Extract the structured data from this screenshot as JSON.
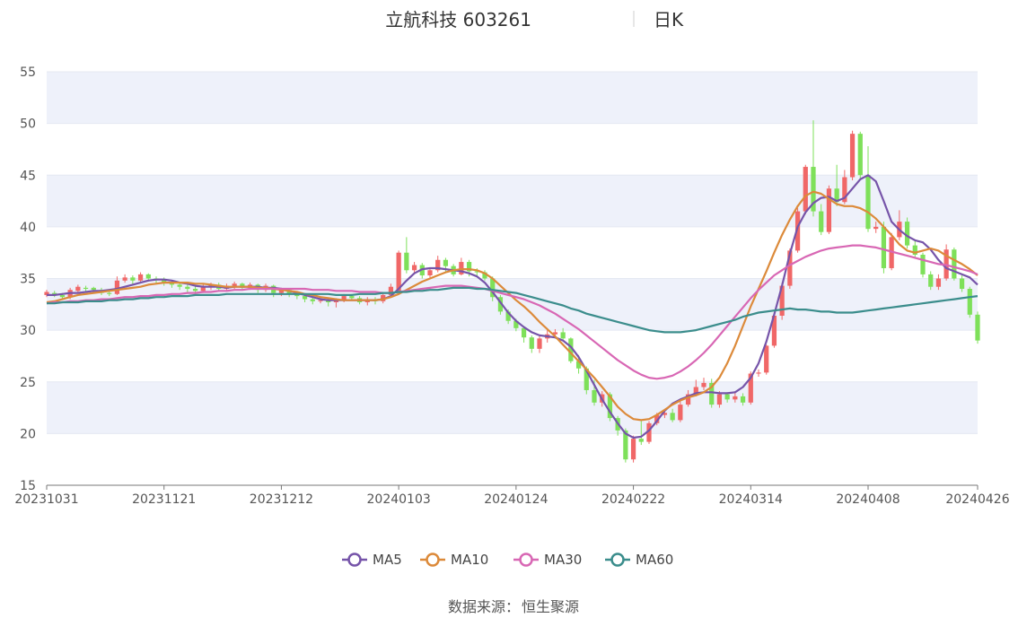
{
  "header": {
    "title": "立航科技 603261",
    "period": "日K"
  },
  "footer": {
    "source_label": "数据来源：",
    "source_value": "恒生聚源"
  },
  "colors": {
    "up": "#f06767",
    "down": "#7ee05a",
    "ma5": "#7654a9",
    "ma10": "#dc8a3a",
    "ma30": "#d867b4",
    "ma60": "#3b8d8c",
    "band": "#eef1fa",
    "axis": "#777777"
  },
  "chart_data": {
    "type": "candlestick",
    "title": "立航科技 603261",
    "subtitle": "日K",
    "ylim": [
      15,
      55
    ],
    "y_ticks": [
      "15",
      "20",
      "25",
      "30",
      "35",
      "40",
      "45",
      "50",
      "55"
    ],
    "x_ticks": [
      "20231031",
      "20231121",
      "20231212",
      "20240103",
      "20240124",
      "20240222",
      "20240314",
      "20240408",
      "20240426"
    ],
    "x_tick_index": [
      0,
      15,
      30,
      45,
      60,
      75,
      90,
      105,
      119
    ],
    "candles": [
      [
        33.4,
        33.7,
        33.2,
        33.9
      ],
      [
        33.6,
        33.4,
        33.2,
        33.8
      ],
      [
        33.4,
        33.2,
        33.0,
        33.6
      ],
      [
        33.2,
        33.9,
        33.0,
        34.1
      ],
      [
        33.8,
        34.2,
        33.6,
        34.4
      ],
      [
        34.1,
        34.0,
        33.7,
        34.3
      ],
      [
        34.1,
        33.9,
        33.6,
        34.2
      ],
      [
        33.9,
        33.6,
        33.4,
        34.1
      ],
      [
        33.6,
        33.5,
        33.3,
        33.9
      ],
      [
        33.5,
        34.8,
        33.4,
        35.2
      ],
      [
        34.8,
        35.1,
        34.6,
        35.4
      ],
      [
        35.1,
        34.8,
        34.4,
        35.3
      ],
      [
        34.8,
        35.4,
        34.6,
        35.6
      ],
      [
        35.4,
        35.0,
        34.7,
        35.5
      ],
      [
        35.0,
        34.9,
        34.5,
        35.2
      ],
      [
        34.9,
        34.6,
        34.3,
        35.1
      ],
      [
        34.6,
        34.4,
        34.1,
        34.8
      ],
      [
        34.4,
        34.2,
        33.9,
        34.6
      ],
      [
        34.2,
        34.0,
        33.7,
        34.4
      ],
      [
        34.0,
        33.8,
        33.5,
        34.3
      ],
      [
        33.8,
        34.2,
        33.6,
        34.5
      ],
      [
        34.2,
        34.4,
        33.9,
        34.6
      ],
      [
        34.4,
        34.0,
        33.8,
        34.6
      ],
      [
        34.0,
        34.3,
        33.8,
        34.5
      ],
      [
        34.3,
        34.5,
        34.0,
        34.7
      ],
      [
        34.5,
        34.1,
        33.9,
        34.6
      ],
      [
        34.1,
        34.4,
        33.9,
        34.6
      ],
      [
        34.4,
        33.9,
        33.6,
        34.5
      ],
      [
        33.9,
        34.3,
        33.7,
        34.5
      ],
      [
        34.3,
        33.6,
        33.2,
        34.4
      ],
      [
        33.6,
        33.9,
        33.3,
        34.1
      ],
      [
        33.9,
        33.5,
        33.2,
        34.0
      ],
      [
        33.5,
        33.3,
        33.0,
        33.7
      ],
      [
        33.3,
        33.0,
        32.7,
        33.4
      ],
      [
        33.0,
        32.8,
        32.5,
        33.2
      ],
      [
        32.8,
        32.9,
        32.6,
        33.2
      ],
      [
        32.9,
        32.7,
        32.3,
        33.1
      ],
      [
        32.7,
        32.9,
        32.2,
        33.1
      ],
      [
        32.9,
        33.3,
        32.7,
        33.5
      ],
      [
        33.3,
        33.1,
        32.9,
        33.5
      ],
      [
        33.1,
        32.7,
        32.5,
        33.3
      ],
      [
        32.7,
        33.0,
        32.4,
        33.2
      ],
      [
        33.0,
        32.8,
        32.5,
        33.2
      ],
      [
        32.8,
        33.4,
        32.6,
        33.6
      ],
      [
        33.4,
        34.2,
        33.2,
        34.5
      ],
      [
        33.8,
        37.5,
        33.6,
        37.7
      ],
      [
        37.5,
        35.8,
        35.5,
        39.0
      ],
      [
        35.8,
        36.3,
        35.5,
        36.6
      ],
      [
        36.3,
        35.3,
        35.0,
        36.5
      ],
      [
        35.3,
        35.8,
        35.1,
        36.0
      ],
      [
        35.8,
        36.8,
        35.6,
        37.2
      ],
      [
        36.8,
        36.2,
        35.6,
        37.0
      ],
      [
        36.2,
        35.4,
        35.2,
        36.4
      ],
      [
        35.4,
        36.6,
        35.3,
        37.0
      ],
      [
        36.6,
        35.7,
        35.2,
        36.8
      ],
      [
        35.7,
        35.6,
        35.2,
        36.0
      ],
      [
        35.6,
        35.0,
        34.8,
        35.8
      ],
      [
        35.0,
        33.2,
        32.8,
        35.2
      ],
      [
        33.2,
        31.8,
        31.5,
        33.4
      ],
      [
        31.8,
        30.9,
        30.6,
        32.0
      ],
      [
        30.9,
        30.2,
        29.9,
        31.1
      ],
      [
        30.2,
        29.3,
        28.8,
        30.4
      ],
      [
        29.3,
        28.2,
        27.8,
        29.5
      ],
      [
        28.2,
        29.2,
        27.8,
        29.5
      ],
      [
        29.2,
        29.6,
        28.8,
        30.0
      ],
      [
        29.6,
        29.8,
        29.3,
        30.1
      ],
      [
        29.8,
        29.2,
        28.9,
        30.2
      ],
      [
        29.2,
        27.0,
        26.8,
        29.3
      ],
      [
        27.0,
        26.3,
        25.8,
        27.6
      ],
      [
        26.3,
        24.2,
        23.8,
        26.5
      ],
      [
        24.2,
        23.0,
        22.7,
        25.2
      ],
      [
        23.0,
        23.8,
        22.6,
        24.1
      ],
      [
        23.8,
        21.5,
        21.2,
        24.0
      ],
      [
        21.5,
        20.3,
        19.8,
        21.7
      ],
      [
        20.3,
        17.5,
        17.2,
        20.5
      ],
      [
        17.5,
        19.5,
        17.2,
        19.8
      ],
      [
        19.5,
        19.2,
        18.9,
        21.2
      ],
      [
        19.2,
        21.0,
        19.0,
        21.2
      ],
      [
        21.0,
        21.8,
        20.8,
        22.0
      ],
      [
        21.8,
        22.0,
        21.5,
        22.3
      ],
      [
        22.0,
        21.3,
        21.1,
        22.4
      ],
      [
        21.3,
        22.8,
        21.1,
        23.1
      ],
      [
        22.8,
        23.8,
        22.6,
        24.2
      ],
      [
        23.8,
        24.5,
        23.6,
        25.2
      ],
      [
        24.5,
        24.9,
        24.2,
        25.4
      ],
      [
        24.9,
        22.8,
        22.5,
        25.3
      ],
      [
        22.8,
        23.8,
        22.5,
        24.1
      ],
      [
        23.8,
        23.3,
        23.0,
        24.0
      ],
      [
        23.3,
        23.6,
        23.0,
        24.1
      ],
      [
        23.6,
        23.0,
        22.7,
        23.9
      ],
      [
        23.0,
        25.8,
        22.8,
        26.0
      ],
      [
        25.8,
        25.9,
        25.5,
        26.2
      ],
      [
        25.9,
        28.5,
        25.7,
        28.6
      ],
      [
        28.5,
        31.4,
        28.3,
        31.6
      ],
      [
        31.4,
        34.3,
        31.0,
        34.6
      ],
      [
        34.3,
        37.7,
        34.0,
        37.9
      ],
      [
        37.7,
        41.5,
        37.5,
        41.8
      ],
      [
        41.5,
        45.8,
        41.2,
        46.0
      ],
      [
        45.8,
        41.5,
        41.0,
        50.3
      ],
      [
        41.5,
        39.5,
        39.2,
        42.2
      ],
      [
        39.5,
        43.7,
        39.3,
        44.0
      ],
      [
        43.7,
        42.4,
        42.0,
        46.0
      ],
      [
        42.4,
        44.8,
        42.2,
        45.5
      ],
      [
        44.8,
        49.0,
        44.5,
        49.3
      ],
      [
        49.0,
        45.0,
        44.5,
        49.2
      ],
      [
        45.0,
        39.8,
        39.5,
        47.8
      ],
      [
        39.8,
        40.0,
        39.4,
        40.5
      ],
      [
        40.0,
        36.0,
        35.5,
        40.5
      ],
      [
        36.0,
        39.0,
        35.8,
        39.4
      ],
      [
        39.0,
        40.5,
        38.7,
        41.6
      ],
      [
        40.5,
        38.2,
        37.9,
        40.9
      ],
      [
        38.2,
        37.3,
        37.0,
        38.6
      ],
      [
        37.3,
        35.4,
        35.1,
        37.5
      ],
      [
        35.4,
        34.2,
        33.9,
        35.7
      ],
      [
        34.2,
        35.0,
        33.9,
        35.4
      ],
      [
        35.0,
        37.8,
        34.8,
        38.3
      ],
      [
        37.8,
        35.0,
        34.8,
        38.0
      ],
      [
        35.0,
        34.0,
        33.7,
        35.3
      ],
      [
        34.0,
        31.5,
        31.2,
        34.2
      ],
      [
        31.5,
        29.0,
        28.7,
        31.8
      ]
    ],
    "series": [
      {
        "name": "MA5",
        "values": [
          33.4,
          33.4,
          33.5,
          33.6,
          33.6,
          33.7,
          33.8,
          33.8,
          33.9,
          34.0,
          34.2,
          34.4,
          34.6,
          34.8,
          34.9,
          34.9,
          34.8,
          34.6,
          34.5,
          34.3,
          34.2,
          34.2,
          34.2,
          34.1,
          34.2,
          34.2,
          34.2,
          34.2,
          34.1,
          34.1,
          34.0,
          33.8,
          33.6,
          33.4,
          33.2,
          33.0,
          32.9,
          32.9,
          32.9,
          32.9,
          32.9,
          32.9,
          32.9,
          33.0,
          33.3,
          34.0,
          34.8,
          35.5,
          35.9,
          36.0,
          36.0,
          35.9,
          35.8,
          35.7,
          35.5,
          35.2,
          34.6,
          33.7,
          32.7,
          31.7,
          30.9,
          30.3,
          29.8,
          29.5,
          29.4,
          29.3,
          29.0,
          28.4,
          27.4,
          26.1,
          24.7,
          23.3,
          22.1,
          21.0,
          20.0,
          19.6,
          19.7,
          20.3,
          21.2,
          22.2,
          22.9,
          23.3,
          23.6,
          23.9,
          24.0,
          24.0,
          23.9,
          23.9,
          24.0,
          24.5,
          25.4,
          26.8,
          28.9,
          31.5,
          34.3,
          37.4,
          40.0,
          41.4,
          42.3,
          42.8,
          42.9,
          42.5,
          42.8,
          43.7,
          44.6,
          45.0,
          44.4,
          42.5,
          40.5,
          39.7,
          39.1,
          38.7,
          38.5,
          37.8,
          36.8,
          36.0,
          35.7,
          35.4,
          35.1,
          34.4
        ]
      },
      {
        "name": "MA10",
        "values": [
          32.7,
          32.8,
          33.0,
          33.2,
          33.4,
          33.5,
          33.6,
          33.7,
          33.8,
          33.9,
          34.0,
          34.1,
          34.2,
          34.4,
          34.5,
          34.6,
          34.6,
          34.6,
          34.6,
          34.5,
          34.5,
          34.4,
          34.3,
          34.2,
          34.2,
          34.2,
          34.2,
          34.1,
          34.1,
          34.0,
          33.9,
          33.8,
          33.7,
          33.5,
          33.4,
          33.2,
          33.1,
          33.0,
          32.9,
          32.9,
          32.9,
          32.9,
          32.9,
          33.0,
          33.2,
          33.5,
          33.9,
          34.3,
          34.7,
          35.0,
          35.3,
          35.6,
          35.8,
          35.9,
          35.9,
          35.8,
          35.5,
          35.0,
          34.3,
          33.6,
          32.9,
          32.3,
          31.6,
          30.8,
          30.1,
          29.4,
          28.6,
          27.8,
          27.0,
          26.2,
          25.4,
          24.5,
          23.6,
          22.6,
          21.9,
          21.4,
          21.3,
          21.4,
          21.8,
          22.3,
          22.8,
          23.2,
          23.5,
          23.7,
          24.0,
          24.5,
          25.4,
          26.8,
          28.5,
          30.4,
          32.3,
          34.0,
          35.7,
          37.5,
          39.2,
          40.7,
          42.0,
          43.0,
          43.4,
          43.2,
          42.7,
          42.2,
          42.0,
          42.0,
          41.8,
          41.4,
          40.8,
          40.0,
          39.2,
          38.3,
          37.7,
          37.5,
          37.7,
          37.9,
          37.7,
          37.2,
          36.8,
          36.4,
          35.9,
          35.3
        ]
      },
      {
        "name": "MA30",
        "values": [
          32.6,
          32.7,
          32.7,
          32.8,
          32.8,
          32.9,
          32.9,
          33.0,
          33.0,
          33.1,
          33.2,
          33.2,
          33.3,
          33.3,
          33.4,
          33.4,
          33.5,
          33.5,
          33.6,
          33.6,
          33.7,
          33.7,
          33.8,
          33.8,
          33.9,
          33.9,
          34.0,
          34.0,
          34.0,
          34.0,
          34.0,
          34.0,
          34.0,
          34.0,
          33.9,
          33.9,
          33.9,
          33.8,
          33.8,
          33.8,
          33.7,
          33.7,
          33.7,
          33.6,
          33.6,
          33.7,
          33.8,
          33.9,
          34.0,
          34.1,
          34.2,
          34.3,
          34.3,
          34.3,
          34.2,
          34.1,
          34.0,
          33.8,
          33.6,
          33.4,
          33.2,
          33.0,
          32.7,
          32.4,
          32.0,
          31.6,
          31.1,
          30.6,
          30.1,
          29.5,
          28.9,
          28.3,
          27.7,
          27.1,
          26.6,
          26.1,
          25.7,
          25.4,
          25.3,
          25.4,
          25.6,
          26.0,
          26.5,
          27.1,
          27.8,
          28.6,
          29.5,
          30.4,
          31.3,
          32.2,
          33.1,
          33.9,
          34.6,
          35.3,
          35.8,
          36.3,
          36.7,
          37.1,
          37.4,
          37.7,
          37.9,
          38.0,
          38.1,
          38.2,
          38.2,
          38.1,
          38.0,
          37.8,
          37.6,
          37.4,
          37.2,
          37.0,
          36.8,
          36.6,
          36.4,
          36.3,
          36.1,
          35.9,
          35.7,
          35.4
        ]
      },
      {
        "name": "MA60",
        "values": [
          32.6,
          32.6,
          32.7,
          32.7,
          32.7,
          32.8,
          32.8,
          32.8,
          32.9,
          32.9,
          33.0,
          33.0,
          33.1,
          33.1,
          33.2,
          33.2,
          33.3,
          33.3,
          33.3,
          33.4,
          33.4,
          33.4,
          33.4,
          33.5,
          33.5,
          33.5,
          33.5,
          33.5,
          33.5,
          33.5,
          33.5,
          33.5,
          33.5,
          33.5,
          33.5,
          33.5,
          33.5,
          33.4,
          33.4,
          33.4,
          33.5,
          33.5,
          33.5,
          33.6,
          33.6,
          33.7,
          33.7,
          33.8,
          33.8,
          33.9,
          33.9,
          34.0,
          34.1,
          34.1,
          34.1,
          34.0,
          34.0,
          33.9,
          33.8,
          33.7,
          33.6,
          33.4,
          33.2,
          33.0,
          32.8,
          32.6,
          32.4,
          32.1,
          31.9,
          31.6,
          31.4,
          31.2,
          31.0,
          30.8,
          30.6,
          30.4,
          30.2,
          30.0,
          29.9,
          29.8,
          29.8,
          29.8,
          29.9,
          30.0,
          30.2,
          30.4,
          30.6,
          30.8,
          31.0,
          31.3,
          31.5,
          31.7,
          31.8,
          31.9,
          32.0,
          32.1,
          32.0,
          32.0,
          31.9,
          31.8,
          31.8,
          31.7,
          31.7,
          31.7,
          31.8,
          31.9,
          32.0,
          32.1,
          32.2,
          32.3,
          32.4,
          32.5,
          32.6,
          32.7,
          32.8,
          32.9,
          33.0,
          33.1,
          33.2,
          33.3
        ]
      }
    ]
  }
}
